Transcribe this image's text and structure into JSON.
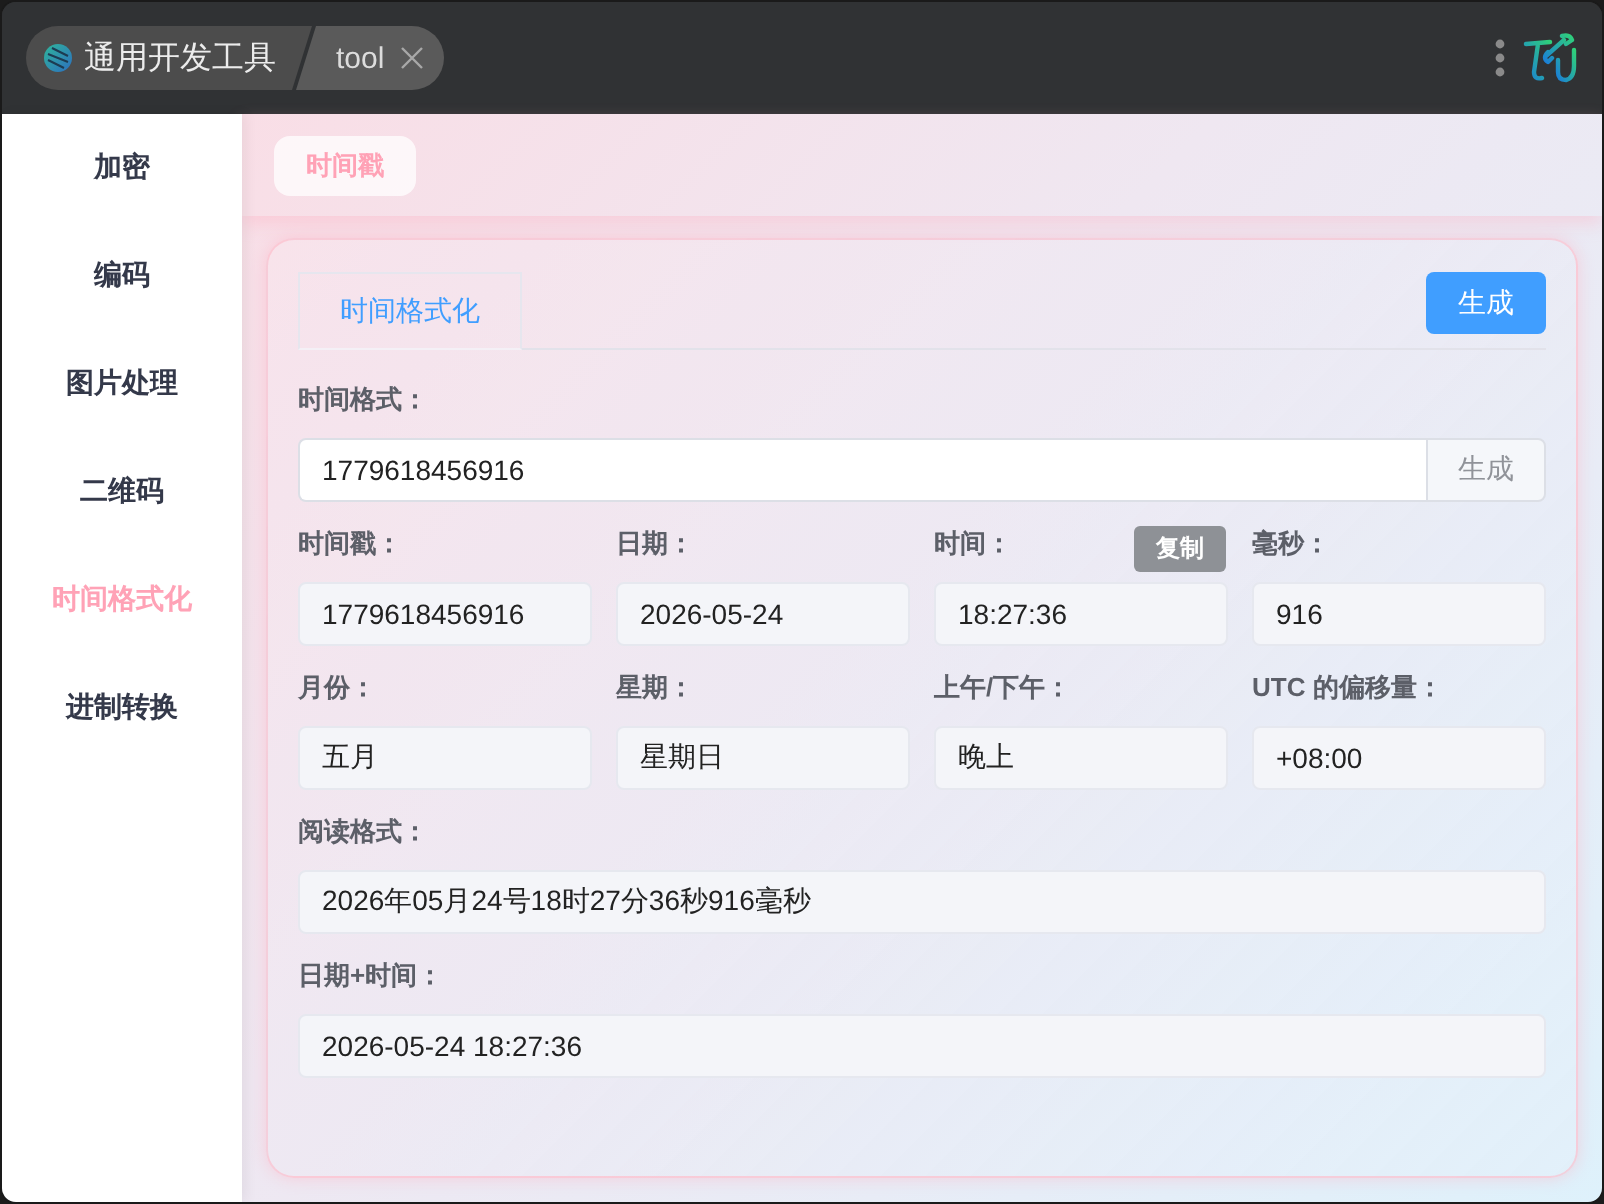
{
  "title_bar": {
    "breadcrumb": {
      "app_name": "通用开发工具",
      "tab": "tool"
    }
  },
  "sidebar": {
    "items": [
      {
        "label": "加密",
        "selected": false
      },
      {
        "label": "编码",
        "selected": false
      },
      {
        "label": "图片处理",
        "selected": false
      },
      {
        "label": "二维码",
        "selected": false
      },
      {
        "label": "时间格式化",
        "selected": true
      },
      {
        "label": "进制转换",
        "selected": false
      }
    ]
  },
  "page_tabs": [
    {
      "label": "时间戳",
      "selected": true
    }
  ],
  "panel": {
    "tabs": [
      {
        "label": "时间格式化",
        "selected": true
      }
    ],
    "generate_button": "生成",
    "format_field": {
      "label": "时间格式：",
      "value": "1779618456916",
      "button": "生成"
    },
    "fields": [
      {
        "label": "时间戳：",
        "value": "1779618456916"
      },
      {
        "label": "日期：",
        "value": "2026-05-24"
      },
      {
        "label": "时间：",
        "value": "18:27:36",
        "badge": "复制"
      },
      {
        "label": "毫秒：",
        "value": "916"
      },
      {
        "label": "月份：",
        "value": "五月"
      },
      {
        "label": "星期：",
        "value": "星期日"
      },
      {
        "label": "上午/下午：",
        "value": "晚上"
      },
      {
        "label": "UTC 的偏移量：",
        "value": "+08:00"
      }
    ],
    "wide_fields": [
      {
        "label": "阅读格式：",
        "value": "2026年05月24号18时27分36秒916毫秒"
      },
      {
        "label": "日期+时间：",
        "value": "2026-05-24 18:27:36"
      }
    ]
  }
}
